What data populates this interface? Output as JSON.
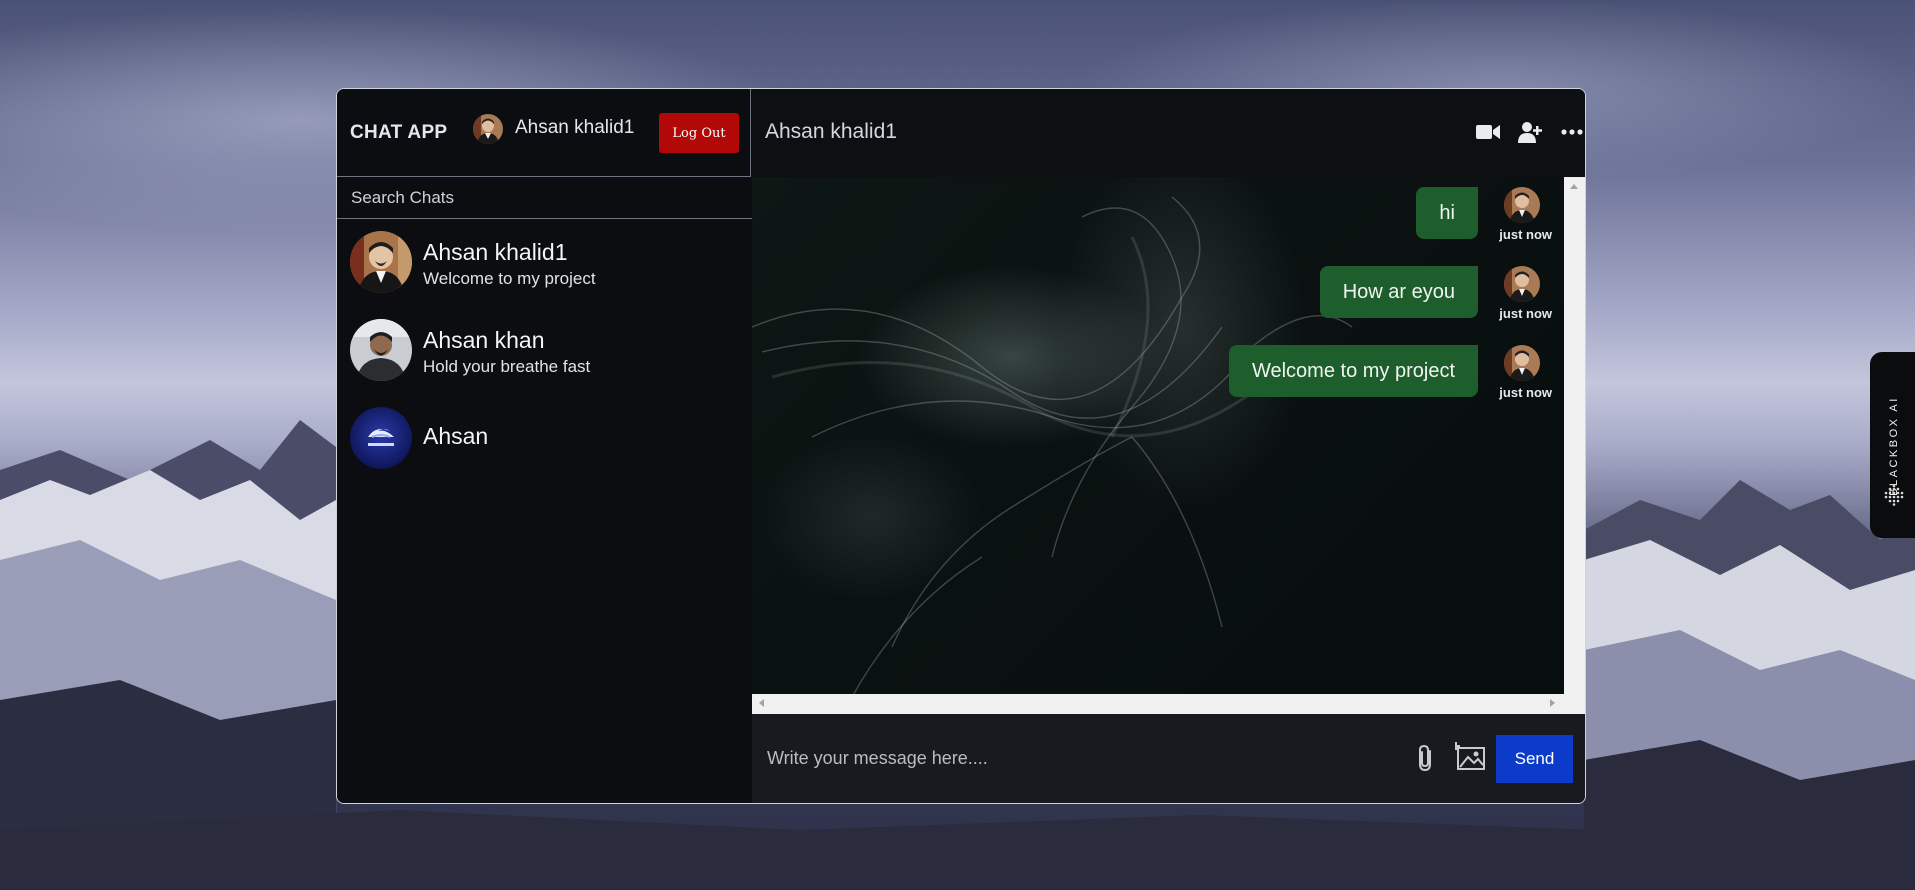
{
  "app": {
    "title": "CHAT APP",
    "current_user": "Ahsan khalid1",
    "logout_label": "Log Out"
  },
  "search": {
    "placeholder": "Search Chats",
    "value": ""
  },
  "chats": [
    {
      "name": "Ahsan khalid1",
      "preview": "Welcome to my project",
      "avatar": "person-photo"
    },
    {
      "name": "Ahsan khan",
      "preview": "Hold your breathe fast",
      "avatar": "person-photo"
    },
    {
      "name": "Ahsan",
      "preview": "",
      "avatar": "logo-image"
    }
  ],
  "conversation": {
    "title": "Ahsan khalid1",
    "header_icons": [
      "video-camera-icon",
      "add-user-icon",
      "more-options-icon"
    ],
    "messages": [
      {
        "text": "hi",
        "time": "just now"
      },
      {
        "text": "How ar eyou",
        "time": "just now"
      },
      {
        "text": "Welcome to my project",
        "time": "just now"
      }
    ]
  },
  "composer": {
    "placeholder": "Write your message here....",
    "value": "",
    "attach_icon": "paperclip-icon",
    "image_icon": "add-image-icon",
    "send_label": "Send"
  },
  "side_tab": {
    "label": "BLACKBOX AI"
  },
  "colors": {
    "logout": "#b30808",
    "bubble": "#1d5e2c",
    "send": "#0c3bc9",
    "panel": "#0d0f12"
  }
}
